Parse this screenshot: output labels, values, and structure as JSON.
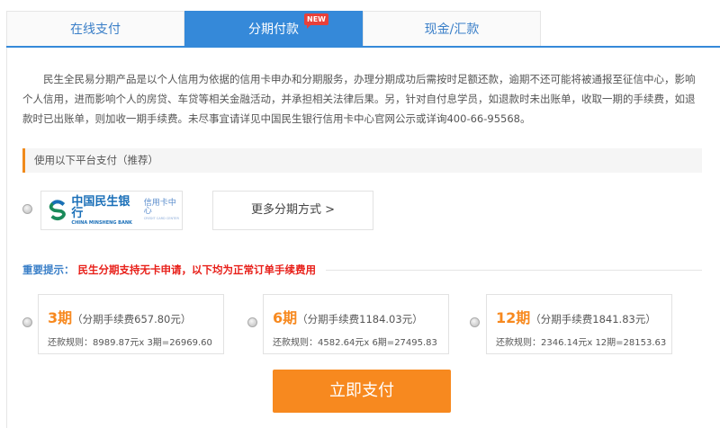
{
  "tabs": [
    {
      "label": "在线支付"
    },
    {
      "label": "分期付款",
      "badge": "NEW"
    },
    {
      "label": "现金/汇款"
    }
  ],
  "intro": "民生全民易分期产品是以个人信用为依据的信用卡申办和分期服务，办理分期成功后需按时足额还款，逾期不还可能将被通报至征信中心，影响个人信用，进而影响个人的房贷、车贷等相关金融活动，并承担相关法律后果。另，针对自付息学员，如退款时未出账单，收取一期的手续费，如退款时已出账单，则加收一期手续费。未尽事宜请详见中国民生银行信用卡中心官网公示或详询400-66-95568。",
  "section_title": "使用以下平台支付（推荐）",
  "bank": {
    "name_cn": "中国民生银行",
    "name_en": "CHINA MINSHENG BANK",
    "sub_cn": "信用卡中心",
    "sub_en": "CREDIT CARD CENTER"
  },
  "more_label": "更多分期方式 >",
  "note": {
    "label": "重要提示：",
    "text": "民生分期支持无卡申请，以下均为正常订单手续费用"
  },
  "plans": [
    {
      "period": "3期",
      "fee": "（分期手续费657.80元）",
      "rule": "还款规则：8989.87元x 3期=26969.60"
    },
    {
      "period": "6期",
      "fee": "（分期手续费1184.03元）",
      "rule": "还款规则：4582.64元x 6期=27495.83"
    },
    {
      "period": "12期",
      "fee": "（分期手续费1841.83元）",
      "rule": "还款规则：2346.14元x 12期=28153.63"
    }
  ],
  "pay_label": "立即支付",
  "colors": {
    "blue": "#3589d9",
    "orange": "#f7891f",
    "red": "#e8201a"
  }
}
